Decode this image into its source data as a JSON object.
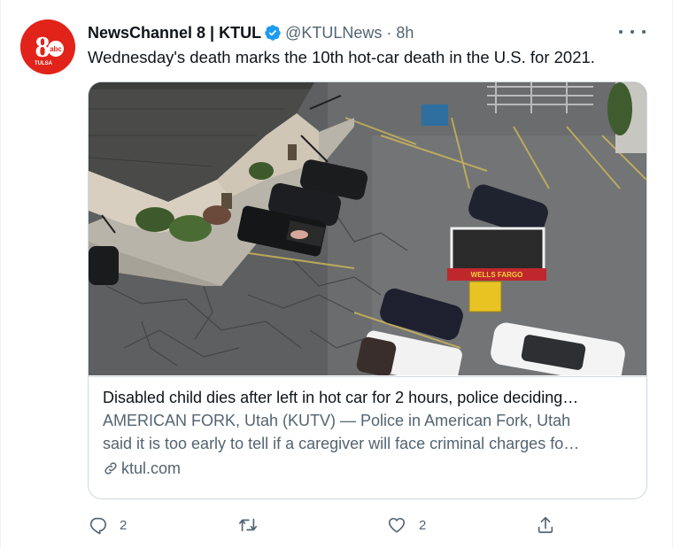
{
  "tweet": {
    "author_name": "NewsChannel 8 | KTUL",
    "handle": "@KTULNews",
    "separator": "·",
    "time": "8h",
    "text": "Wednesday's death marks the 10th hot-car death in the U.S. for 2021."
  },
  "avatar": {
    "logo_number": "8",
    "logo_network": "abc",
    "logo_city": "TULSA"
  },
  "card": {
    "image_sign_text": "WELLS FARGO",
    "title": "Disabled child dies after left in hot car for 2 hours, police deciding…",
    "description_line1": "AMERICAN FORK, Utah (KUTV) — Police in American Fork, Utah",
    "description_line2": "said it is too early to tell if a caregiver will face criminal charges fo…",
    "domain": "ktul.com"
  },
  "actions": {
    "reply_count": "2",
    "retweet_count": "",
    "like_count": "2"
  },
  "colors": {
    "brand_red": "#e2231a",
    "verified_blue": "#1d9bf0",
    "secondary_text": "#536471",
    "primary_text": "#0f1419",
    "border": "#cfd9de"
  },
  "icons": [
    "verified-badge-icon",
    "more-options-icon",
    "link-icon",
    "reply-icon",
    "retweet-icon",
    "like-icon",
    "share-icon"
  ]
}
